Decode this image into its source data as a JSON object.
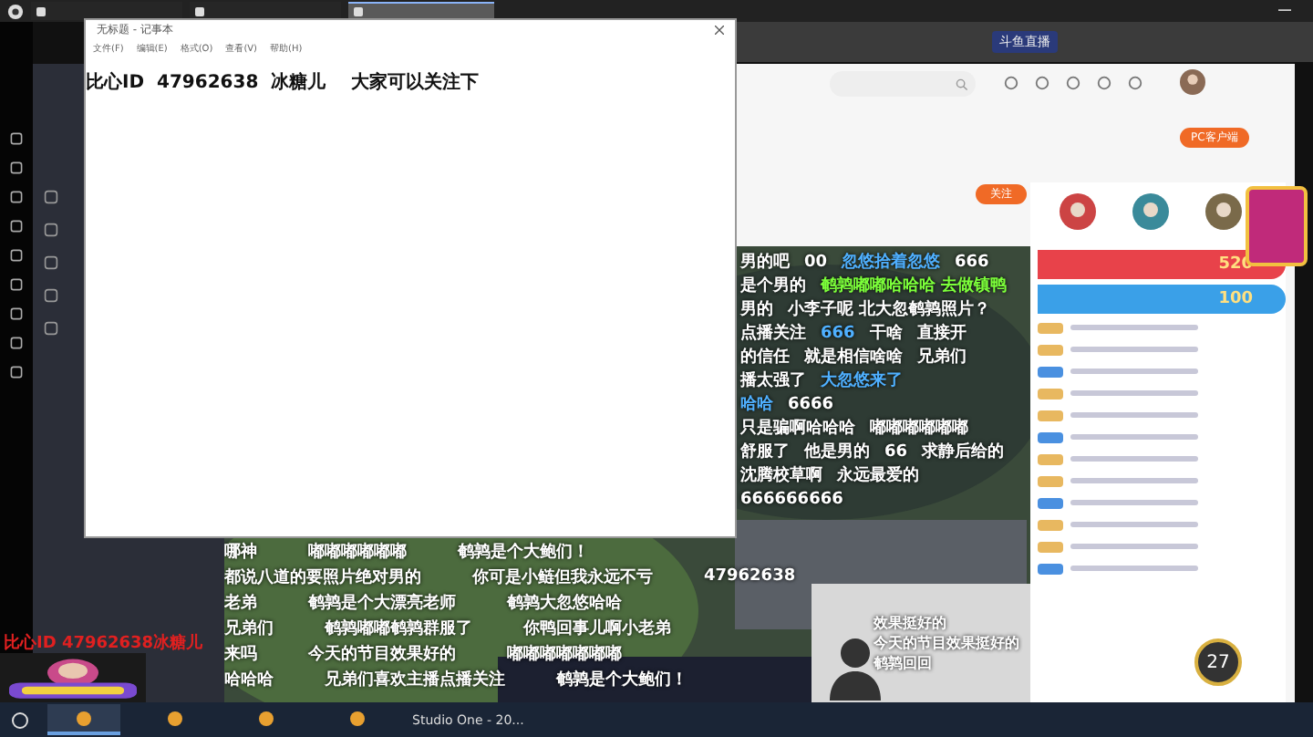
{
  "browser": {
    "tabs": [
      {
        "selected": false
      },
      {
        "selected": false
      },
      {
        "selected": true
      }
    ],
    "address": "斗鱼直播"
  },
  "notepad": {
    "title": "无标题 - 记事本",
    "menu": [
      "文件(F)",
      "编辑(E)",
      "格式(O)",
      "查看(V)",
      "帮助(H)"
    ],
    "text": "比心ID  47962638  冰糖儿    大家可以关注下"
  },
  "page": {
    "client_button": "PC客户端",
    "follow_button": "关注"
  },
  "danmaku_upper": [
    [
      {
        "text": "男的吧"
      },
      {
        "text": "00"
      },
      {
        "text": "忽悠拾着忽悠",
        "color": "#4fb0ff"
      },
      {
        "text": "666"
      }
    ],
    [
      {
        "text": "是个男的"
      },
      {
        "text": "鹌鹑嘟嘟哈哈哈 去做镇鸭",
        "color": "#7cff3a"
      }
    ],
    [
      {
        "text": "男的"
      },
      {
        "text": "小李子呢 北大忽鹌鹑照片？"
      }
    ],
    [
      {
        "text": "点播关注"
      },
      {
        "text": "666",
        "color": "#4fb0ff"
      },
      {
        "text": "干啥"
      },
      {
        "text": "直接开"
      }
    ],
    [
      {
        "text": "的信任"
      },
      {
        "text": "就是相信啥啥"
      },
      {
        "text": "兄弟们"
      }
    ],
    [
      {
        "text": "播太强了"
      },
      {
        "text": "大忽悠来了",
        "color": "#4fb0ff"
      }
    ],
    [
      {
        "text": "哈哈",
        "color": "#4fb0ff"
      },
      {
        "text": "6666"
      }
    ],
    [
      {
        "text": "只是骗啊哈哈哈"
      },
      {
        "text": "嘟嘟嘟嘟嘟嘟"
      }
    ],
    [
      {
        "text": "舒服了"
      },
      {
        "text": "他是男的"
      },
      {
        "text": "66"
      },
      {
        "text": "求静后给的"
      }
    ],
    [
      {
        "text": "沈腾校草啊"
      },
      {
        "text": "永远最爱的"
      }
    ],
    [
      {
        "text": "666666666"
      }
    ]
  ],
  "danmaku_lower": [
    [
      {
        "text": "哪神"
      },
      {
        "text": "嘟嘟嘟嘟嘟嘟"
      },
      {
        "text": "鹌鹑是个大鲍们！"
      }
    ],
    [
      {
        "text": "都说八道的要照片绝对男的"
      },
      {
        "text": "你可是小鲢但我永远不亏"
      },
      {
        "text": "47962638"
      }
    ],
    [
      {
        "text": "老弟"
      },
      {
        "text": "鹌鹑是个大漂亮老师"
      },
      {
        "text": "鹌鹑大忽悠哈哈"
      }
    ],
    [
      {
        "text": "兄弟们"
      },
      {
        "text": "鹌鹑嘟嘟鹌鹑群服了"
      },
      {
        "text": "你鸭回事儿啊小老弟"
      }
    ],
    [
      {
        "text": "来吗"
      },
      {
        "text": "今天的节目效果好的"
      },
      {
        "text": "嘟嘟嘟嘟嘟嘟嘟"
      }
    ],
    [
      {
        "text": "哈哈哈"
      },
      {
        "text": "兄弟们喜欢主播点播关注"
      },
      {
        "text": "鹌鹑是个大鲍们！"
      }
    ]
  ],
  "webcam_overlay": [
    "效果挺好的",
    "今天的节目效果挺好的",
    "鹌鹑回回"
  ],
  "gifts": [
    {
      "amount": "520",
      "color": "#e8424a"
    },
    {
      "amount": "100",
      "color": "#3aa0e8"
    }
  ],
  "viewer_badge": "27",
  "side_overlay": "比心ID 47962638冰糖儿",
  "taskbar": {
    "apps": [
      {
        "selected": true
      },
      {
        "selected": false
      },
      {
        "selected": false
      },
      {
        "selected": false
      }
    ],
    "studio": "Studio One - 20..."
  }
}
